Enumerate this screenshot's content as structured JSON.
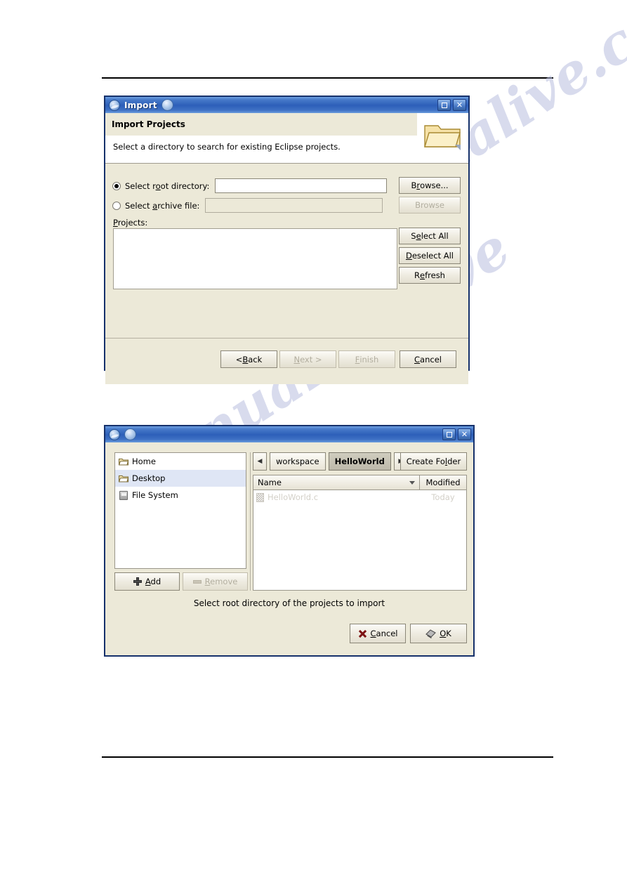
{
  "watermark": {
    "line1": "manualive.com",
    "line2": "manualarchive"
  },
  "import_dialog": {
    "title": "Import",
    "icon": "eclipse-icon",
    "titlebar_buttons": {
      "maximize": "maximize-button",
      "close": "close-button"
    },
    "header": {
      "title": "Import Projects",
      "description": "Select a directory to search for existing Eclipse projects.",
      "banner_icon": "folder-icon"
    },
    "root_directory": {
      "label_prefix": "Select r",
      "label_mnemonic": "o",
      "label_suffix": "ot directory:",
      "label_full": "Select root directory:",
      "selected": true,
      "value": "",
      "browse_prefix": "B",
      "browse_mnemonic": "r",
      "browse_suffix": "owse...",
      "browse_label": "Browse...",
      "browse_enabled": true
    },
    "archive_file": {
      "label_prefix": "Select ",
      "label_mnemonic": "a",
      "label_suffix": "rchive file:",
      "label_full": "Select archive file:",
      "selected": false,
      "value": "",
      "browse_label": "Browse",
      "browse_enabled": false
    },
    "projects": {
      "label_mnemonic": "P",
      "label_suffix": "rojects:",
      "label_full": "Projects:",
      "items": []
    },
    "list_buttons": [
      {
        "name": "select-all",
        "prefix": "S",
        "mnemonic": "e",
        "suffix": "lect All",
        "label": "Select All",
        "enabled": true
      },
      {
        "name": "deselect-all",
        "prefix": "",
        "mnemonic": "D",
        "suffix": "eselect All",
        "label": "Deselect All",
        "enabled": true
      },
      {
        "name": "refresh",
        "prefix": "R",
        "mnemonic": "e",
        "suffix": "fresh",
        "label": "Refresh",
        "enabled": true
      }
    ],
    "footer_buttons": [
      {
        "name": "back",
        "prefix": "< ",
        "mnemonic": "B",
        "suffix": "ack",
        "label": "< Back",
        "enabled": true
      },
      {
        "name": "next",
        "prefix": "",
        "mnemonic": "N",
        "suffix": "ext >",
        "label": "Next >",
        "enabled": false
      },
      {
        "name": "finish",
        "prefix": "",
        "mnemonic": "F",
        "suffix": "inish",
        "label": "Finish",
        "enabled": false
      },
      {
        "name": "cancel",
        "prefix": "",
        "mnemonic": "C",
        "suffix": "ancel",
        "label": "Cancel",
        "enabled": true
      }
    ]
  },
  "chooser_dialog": {
    "title": "",
    "icons": [
      "eclipse-icon",
      "globe-icon"
    ],
    "places": [
      {
        "name": "home",
        "label": "Home",
        "icon": "folder-icon",
        "selected": false
      },
      {
        "name": "desktop",
        "label": "Desktop",
        "icon": "folder-icon",
        "selected": true
      },
      {
        "name": "file-system",
        "label": "File System",
        "icon": "drive-icon",
        "selected": false
      }
    ],
    "place_buttons": {
      "add_prefix": "",
      "add_mnemonic": "A",
      "add_suffix": "dd",
      "add_label": "Add",
      "add_enabled": true,
      "remove_prefix": "",
      "remove_mnemonic": "R",
      "remove_suffix": "emove",
      "remove_label": "Remove",
      "remove_enabled": false
    },
    "pathbar": {
      "prev_icon": "triangle-left-icon",
      "next_icon": "triangle-right-icon",
      "crumbs": [
        {
          "label": "workspace",
          "active": false
        },
        {
          "label": "HelloWorld",
          "active": true
        }
      ],
      "create_folder_prefix": "Create Fo",
      "create_folder_mnemonic": "l",
      "create_folder_suffix": "der",
      "create_folder_label": "Create Folder"
    },
    "file_list": {
      "columns": [
        "Name",
        "Modified"
      ],
      "sort_icon": "sort-descending-icon",
      "rows": [
        {
          "name": "HelloWorld.c",
          "modified": "Today",
          "enabled": false,
          "icon": "file-icon"
        }
      ]
    },
    "status": "Select root directory of the projects to import",
    "buttons": [
      {
        "name": "cancel",
        "prefix": "",
        "mnemonic": "C",
        "suffix": "ancel",
        "label": "Cancel",
        "icon": "x-icon"
      },
      {
        "name": "ok",
        "prefix": "",
        "mnemonic": "O",
        "suffix": "K",
        "label": "OK",
        "icon": "ok-icon"
      }
    ]
  }
}
